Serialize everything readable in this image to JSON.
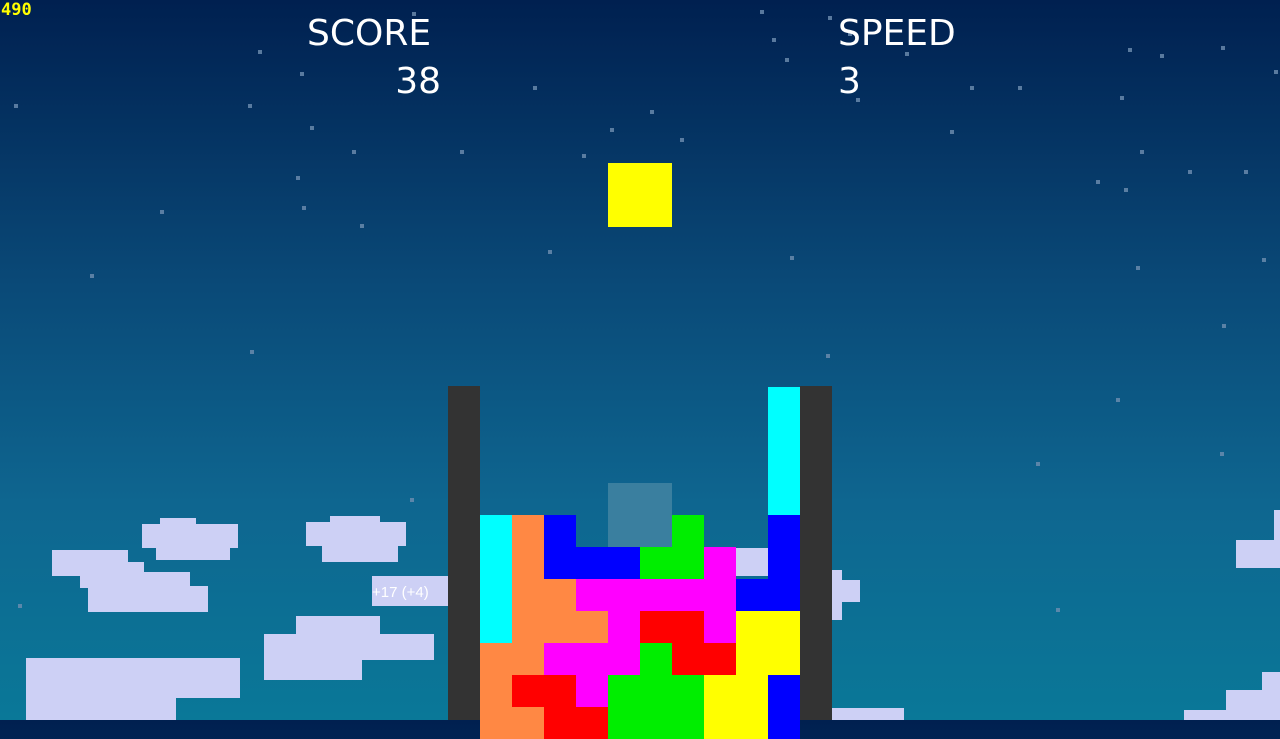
{
  "fps_counter": "490",
  "hud": {
    "score_label": "SCORE",
    "score_value": "38",
    "speed_label": "SPEED",
    "speed_value": "3"
  },
  "score_popup": "+17 (+4)",
  "colors": {
    "cyan": "#00ffff",
    "orange": "#ff8844",
    "blue": "#0000ff",
    "green": "#00ee00",
    "magenta": "#ff00ff",
    "red": "#ff0000",
    "yellow": "#ffff00",
    "ghost": "#3a7f9f",
    "wall": "#333333"
  },
  "board": {
    "columns": 10,
    "rows_visible": 10,
    "active_piece": {
      "shape": "O",
      "color": "yellow",
      "col": 4,
      "row": -7
    },
    "ghost_piece": {
      "shape": "O",
      "col": 4,
      "row": 3
    },
    "grid": [
      [
        "",
        "",
        "",
        "",
        "",
        "",
        "",
        "",
        "",
        "cyan"
      ],
      [
        "",
        "",
        "",
        "",
        "",
        "",
        "",
        "",
        "",
        "cyan"
      ],
      [
        "",
        "",
        "",
        "",
        "",
        "",
        "",
        "",
        "",
        "cyan"
      ],
      [
        "",
        "",
        "",
        "",
        "",
        "",
        "",
        "",
        "",
        "cyan"
      ],
      [
        "cyan",
        "orange",
        "blue",
        "",
        "",
        "green",
        "green",
        "",
        "",
        "blue"
      ],
      [
        "cyan",
        "orange",
        "blue",
        "blue",
        "blue",
        "green",
        "green",
        "magenta",
        "",
        "blue"
      ],
      [
        "cyan",
        "orange",
        "orange",
        "magenta",
        "magenta",
        "magenta",
        "magenta",
        "magenta",
        "blue",
        "blue"
      ],
      [
        "cyan",
        "orange",
        "orange",
        "orange",
        "magenta",
        "red",
        "red",
        "magenta",
        "yellow",
        "yellow"
      ],
      [
        "orange",
        "orange",
        "magenta",
        "magenta",
        "magenta",
        "green",
        "red",
        "red",
        "yellow",
        "yellow"
      ],
      [
        "orange",
        "red",
        "red",
        "magenta",
        "green",
        "green",
        "green",
        "yellow",
        "yellow",
        "blue"
      ],
      [
        "orange",
        "orange",
        "red",
        "red",
        "green",
        "green",
        "green",
        "yellow",
        "yellow",
        "blue"
      ]
    ]
  }
}
